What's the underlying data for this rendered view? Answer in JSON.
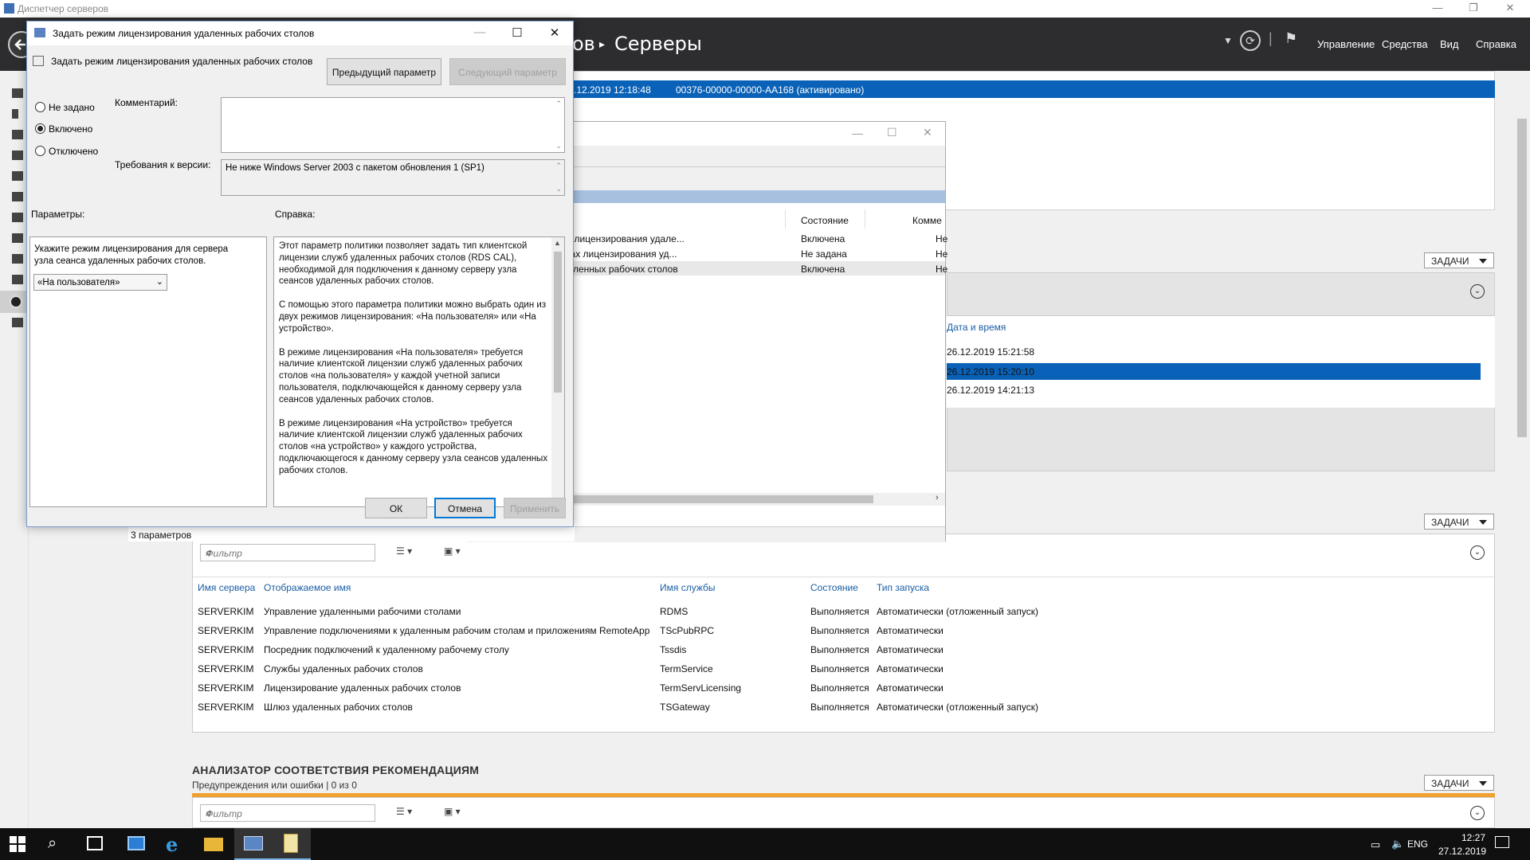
{
  "window": {
    "title": "Диспетчер серверов",
    "breadcrumb_partial": "ов",
    "breadcrumb_current": "Серверы",
    "menu": [
      "Управление",
      "Средства",
      "Вид",
      "Справка"
    ]
  },
  "licensing_row": {
    "date": ".12.2019 12:18:48",
    "key": "00376-00000-00000-AA168 (активировано)"
  },
  "bg_dialog": {
    "columns": [
      "Состояние",
      "Комме"
    ],
    "rows": [
      {
        "name": "ать указанные серверы лицензирования удале...",
        "state": "Включена",
        "comment": "Не"
      },
      {
        "name": "ведомления о проблемах лицензирования уд...",
        "state": "Не задана",
        "comment": "Не"
      },
      {
        "name": "им лицензирования удаленных рабочих столов",
        "state": "Включена",
        "comment": "Не"
      }
    ],
    "count_label": "3 параметров"
  },
  "events": {
    "tasks_label": "ЗАДАЧИ",
    "col_date": "Дата и время",
    "rows": [
      "26.12.2019 15:21:58",
      "26.12.2019 15:20:10",
      "26.12.2019 14:21:13"
    ]
  },
  "services": {
    "tasks_label": "ЗАДАЧИ",
    "filter_placeholder": "Фильтр",
    "columns": [
      "Имя сервера",
      "Отображаемое имя",
      "Имя службы",
      "Состояние",
      "Тип запуска"
    ],
    "rows": [
      [
        "SERVERKIM",
        "Управление удаленными рабочими столами",
        "RDMS",
        "Выполняется",
        "Автоматически (отложенный запуск)"
      ],
      [
        "SERVERKIM",
        "Управление подключениями к удаленным рабочим столам и приложениям RemoteApp",
        "TScPubRPC",
        "Выполняется",
        "Автоматически"
      ],
      [
        "SERVERKIM",
        "Посредник подключений к удаленному рабочему столу",
        "Tssdis",
        "Выполняется",
        "Автоматически"
      ],
      [
        "SERVERKIM",
        "Службы удаленных рабочих столов",
        "TermService",
        "Выполняется",
        "Автоматически"
      ],
      [
        "SERVERKIM",
        "Лицензирование удаленных рабочих столов",
        "TermServLicensing",
        "Выполняется",
        "Автоматически"
      ],
      [
        "SERVERKIM",
        "Шлюз удаленных рабочих столов",
        "TSGateway",
        "Выполняется",
        "Автоматически (отложенный запуск)"
      ]
    ]
  },
  "bpa": {
    "title": "АНАЛИЗАТОР СООТВЕТСТВИЯ РЕКОМЕНДАЦИЯМ",
    "subtitle": "Предупреждения или ошибки | 0 из 0",
    "tasks_label": "ЗАДАЧИ",
    "filter_placeholder": "Фильтр"
  },
  "dialog": {
    "title": "Задать режим лицензирования удаленных рабочих столов",
    "setting_name": "Задать режим лицензирования удаленных рабочих столов",
    "prev_button": "Предыдущий параметр",
    "next_button": "Следующий параметр",
    "radio_not_configured": "Не задано",
    "radio_enabled": "Включено",
    "radio_disabled": "Отключено",
    "comment_label": "Комментарий:",
    "comment_value": "",
    "requirements_label": "Требования к версии:",
    "requirements_value": "Не ниже Windows Server 2003 с пакетом обновления 1 (SP1)",
    "options_label": "Параметры:",
    "help_label": "Справка:",
    "option_text": "Укажите режим лицензирования для сервера узла сеанса удаленных рабочих столов.",
    "option_select": "«На пользователя»",
    "help_paragraphs": [
      "Этот параметр политики позволяет задать тип клиентской лицензии служб удаленных рабочих столов (RDS CAL), необходимой для подключения к данному серверу узла сеансов удаленных рабочих столов.",
      "С помощью этого параметра политики можно выбрать один из двух режимов лицензирования: «На пользователя» или «На устройство».",
      "В режиме лицензирования «На пользователя» требуется наличие клиентской лицензии служб удаленных рабочих столов «на пользователя» у каждой учетной записи пользователя, подключающейся к данному серверу узла сеансов удаленных рабочих столов.",
      "В режиме лицензирования «На устройство» требуется наличие клиентской лицензии служб удаленных рабочих столов «на устройство» у каждого устройства, подключающегося к данному серверу узла сеансов удаленных рабочих столов."
    ],
    "ok_button": "ОК",
    "cancel_button": "Отмена",
    "apply_button": "Применить"
  },
  "taskbar": {
    "lang": "ENG",
    "time": "12:27",
    "date": "27.12.2019"
  },
  "colors": {
    "selection": "#0a62b8",
    "header_bg": "#2d2d30",
    "bpa_bar": "#f0a030"
  }
}
